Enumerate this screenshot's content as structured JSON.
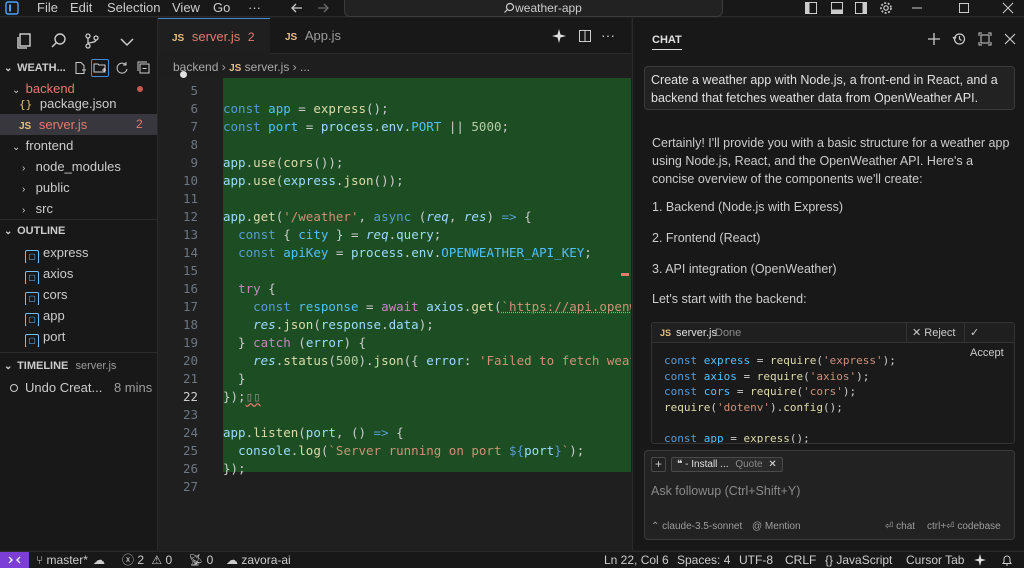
{
  "titlebar": {
    "menus": [
      "File",
      "Edit",
      "Selection",
      "View",
      "Go",
      "···"
    ],
    "search_text": "weather-app"
  },
  "sidebar": {
    "project_title": "WEATH...",
    "files": [
      {
        "label": "backend",
        "type": "folder-open",
        "color": "#e37b6f"
      },
      {
        "label": "package.json",
        "type": "file"
      },
      {
        "label": "server.js",
        "type": "file",
        "badge": "2"
      },
      {
        "label": "frontend",
        "type": "folder-open"
      },
      {
        "label": "node_modules",
        "type": "folder"
      },
      {
        "label": "public",
        "type": "folder"
      },
      {
        "label": "src",
        "type": "folder"
      }
    ],
    "outline_title": "OUTLINE",
    "outline_items": [
      "express",
      "axios",
      "cors",
      "app",
      "port"
    ],
    "timeline_title": "TIMELINE",
    "timeline_file": "server.js",
    "timeline_entry": "Undo Creat...",
    "timeline_time": "8 mins"
  },
  "tabs": [
    {
      "label": "server.js",
      "badge": "2",
      "active": true
    },
    {
      "label": "App.js",
      "active": false
    }
  ],
  "breadcrumb": {
    "folder": "backend",
    "file": "server.js",
    "more": "..."
  },
  "editor": {
    "line_numbers": [
      "5",
      "6",
      "7",
      "8",
      "9",
      "10",
      "11",
      "12",
      "13",
      "14",
      "15",
      "16",
      "17",
      "18",
      "19",
      "20",
      "21",
      "22",
      "23",
      "24",
      "25",
      "26",
      "27"
    ],
    "active_line": "22"
  },
  "chat": {
    "title": "CHAT",
    "user_message": "Create a weather app with Node.js, a front-end in React, and a backend that fetches weather data from OpenWeather API.",
    "reply_intro": "Certainly! I'll provide you with a basic structure for a weather app using Node.js, React, and the OpenWeather API. Here's a concise overview of the components we'll create:",
    "list": [
      "1. Backend (Node.js with Express)",
      "2. Frontend (React)",
      "3. API integration (OpenWeather)"
    ],
    "reply_next": "Let's start with the backend:",
    "card": {
      "filename": "server.js",
      "status": "Done",
      "reject": "Reject",
      "accept": "Accept"
    },
    "followup": {
      "chip_label": "- Install ...",
      "chip_tag": "Quote",
      "placeholder": "Ask followup (Ctrl+Shift+Y)",
      "model": "claude-3.5-sonnet",
      "mention": "@ Mention",
      "chat_action": "chat",
      "codebase_action": "ctrl+⏎ codebase"
    }
  },
  "statusbar": {
    "branch": "master*",
    "errors": "2",
    "warnings": "0",
    "ports": "0",
    "user": "zavora-ai",
    "position": "Ln 22, Col 6",
    "spaces": "Spaces: 4",
    "encoding": "UTF-8",
    "eol": "CRLF",
    "language": "JavaScript",
    "cursor_tab": "Cursor Tab"
  },
  "colors": {
    "accent_purple": "#7b3fd8",
    "diff_green": "#1d4d22",
    "error_red": "#e37b6f"
  }
}
